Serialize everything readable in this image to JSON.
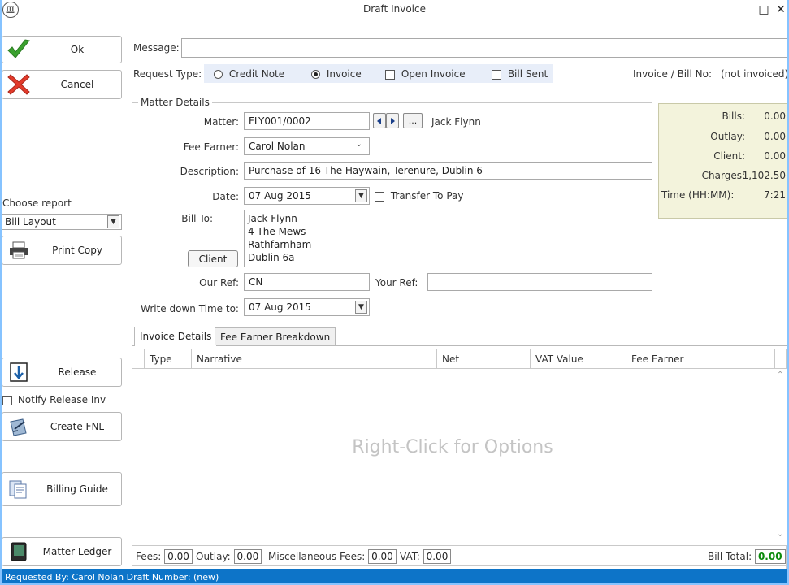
{
  "window": {
    "title": "Draft Invoice",
    "maximize_glyph": "□",
    "close_glyph": "✕"
  },
  "toolbar": {
    "ok_label": "Ok",
    "cancel_label": "Cancel",
    "choose_report_label": "Choose report",
    "report_selected": "Bill Layout",
    "print_copy_label": "Print Copy",
    "release_label": "Release",
    "notify_release_label": "Notify Release Inv",
    "create_fnl_label": "Create FNL",
    "billing_guide_label": "Billing Guide",
    "matter_ledger_label": "Matter Ledger"
  },
  "message": {
    "label": "Message:",
    "value": ""
  },
  "request_type": {
    "label": "Request Type:",
    "options": [
      "Credit Note",
      "Invoice"
    ],
    "selected": "Invoice",
    "open_invoice_label": "Open Invoice",
    "bill_sent_label": "Bill Sent",
    "invoice_no_label": "Invoice / Bill No:",
    "invoice_no_value": "(not invoiced)"
  },
  "matter": {
    "group_title": "Matter Details",
    "matter_label": "Matter:",
    "matter_value": "FLY001/0002",
    "ellipsis": "...",
    "client_name": "Jack Flynn",
    "fee_earner_label": "Fee Earner:",
    "fee_earner_value": "Carol Nolan",
    "description_label": "Description:",
    "description_value": "Purchase of 16 The Haywain, Terenure, Dublin 6",
    "date_label": "Date:",
    "date_value": "07 Aug 2015",
    "transfer_to_pay_label": "Transfer To Pay",
    "bill_to_label": "Bill To:",
    "bill_to_lines": [
      "Jack Flynn",
      "4 The Mews",
      "Rathfarnham",
      "Dublin 6a"
    ],
    "client_button_label": "Client",
    "our_ref_label": "Our Ref:",
    "our_ref_value": "CN",
    "your_ref_label": "Your Ref:",
    "your_ref_value": "",
    "write_down_label": "Write down Time to:",
    "write_down_value": "07 Aug 2015"
  },
  "summary": {
    "rows": [
      {
        "label": "Bills:",
        "value": "0.00"
      },
      {
        "label": "Outlay:",
        "value": "0.00"
      },
      {
        "label": "Client:",
        "value": "0.00"
      },
      {
        "label": "Charges:",
        "value": "1,102.50"
      },
      {
        "label": "Time (HH:MM):",
        "value": "7:21"
      }
    ]
  },
  "tabs": [
    {
      "label": "Invoice Details",
      "active": true
    },
    {
      "label": "Fee Earner Breakdown",
      "active": false
    }
  ],
  "grid": {
    "columns": [
      "Type",
      "Narrative",
      "Net",
      "VAT Value",
      "Fee Earner"
    ],
    "empty_hint": "Right-Click for Options"
  },
  "totals": {
    "fees_label": "Fees:",
    "fees_value": "0.00",
    "outlay_label": "Outlay:",
    "outlay_value": "0.00",
    "misc_label": "Miscellaneous Fees:",
    "misc_value": "0.00",
    "vat_label": "VAT:",
    "vat_value": "0.00",
    "bill_total_label": "Bill Total:",
    "bill_total_value": "0.00"
  },
  "status": {
    "text": "Requested By: Carol Nolan  Draft Number: (new)"
  },
  "colors": {
    "accent": "#0d74c8",
    "summary_bg": "#f3f3dc",
    "total_green": "#0a8a0a"
  }
}
